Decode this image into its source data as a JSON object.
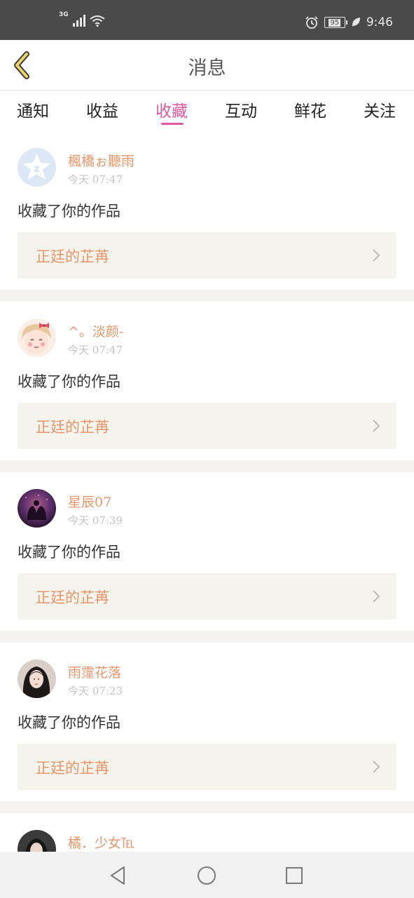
{
  "status_bar": {
    "network": "3G",
    "battery": "95",
    "time": "9:46"
  },
  "header": {
    "title": "消息",
    "back_icon": "chevron-left-icon"
  },
  "tabs": [
    {
      "label": "通知",
      "active": false
    },
    {
      "label": "收益",
      "active": false
    },
    {
      "label": "收藏",
      "active": true
    },
    {
      "label": "互动",
      "active": false
    },
    {
      "label": "鲜花",
      "active": false
    },
    {
      "label": "关注",
      "active": false
    }
  ],
  "colors": {
    "accent": "#e15a9f",
    "name": "#e8956a",
    "work_bg": "#f4f3ec",
    "separator": "#f6f4f2"
  },
  "messages": [
    {
      "user": "楓橋ぉ聽雨",
      "time": "今天 07:47",
      "action": "收藏了你的作品",
      "work": "正廷的芷苒",
      "avatar": "qq-default-avatar"
    },
    {
      "user": "^。淡颜-",
      "time": "今天 07:47",
      "action": "收藏了你的作品",
      "work": "正廷的芷苒",
      "avatar": "cartoon-girl-avatar"
    },
    {
      "user": "星辰07",
      "time": "今天 07:39",
      "action": "收藏了你的作品",
      "work": "正廷的芷苒",
      "avatar": "purple-sky-avatar"
    },
    {
      "user": "雨霪花落",
      "time": "今天 07:23",
      "action": "收藏了你的作品",
      "work": "正廷的芷苒",
      "avatar": "girl-photo-avatar"
    },
    {
      "user": "橘．少女℡",
      "time": "",
      "action": "",
      "work": "",
      "avatar": "girl-photo-avatar"
    }
  ],
  "navbar": {
    "back": "triangle-back-icon",
    "home": "circle-home-icon",
    "recents": "square-recents-icon"
  }
}
